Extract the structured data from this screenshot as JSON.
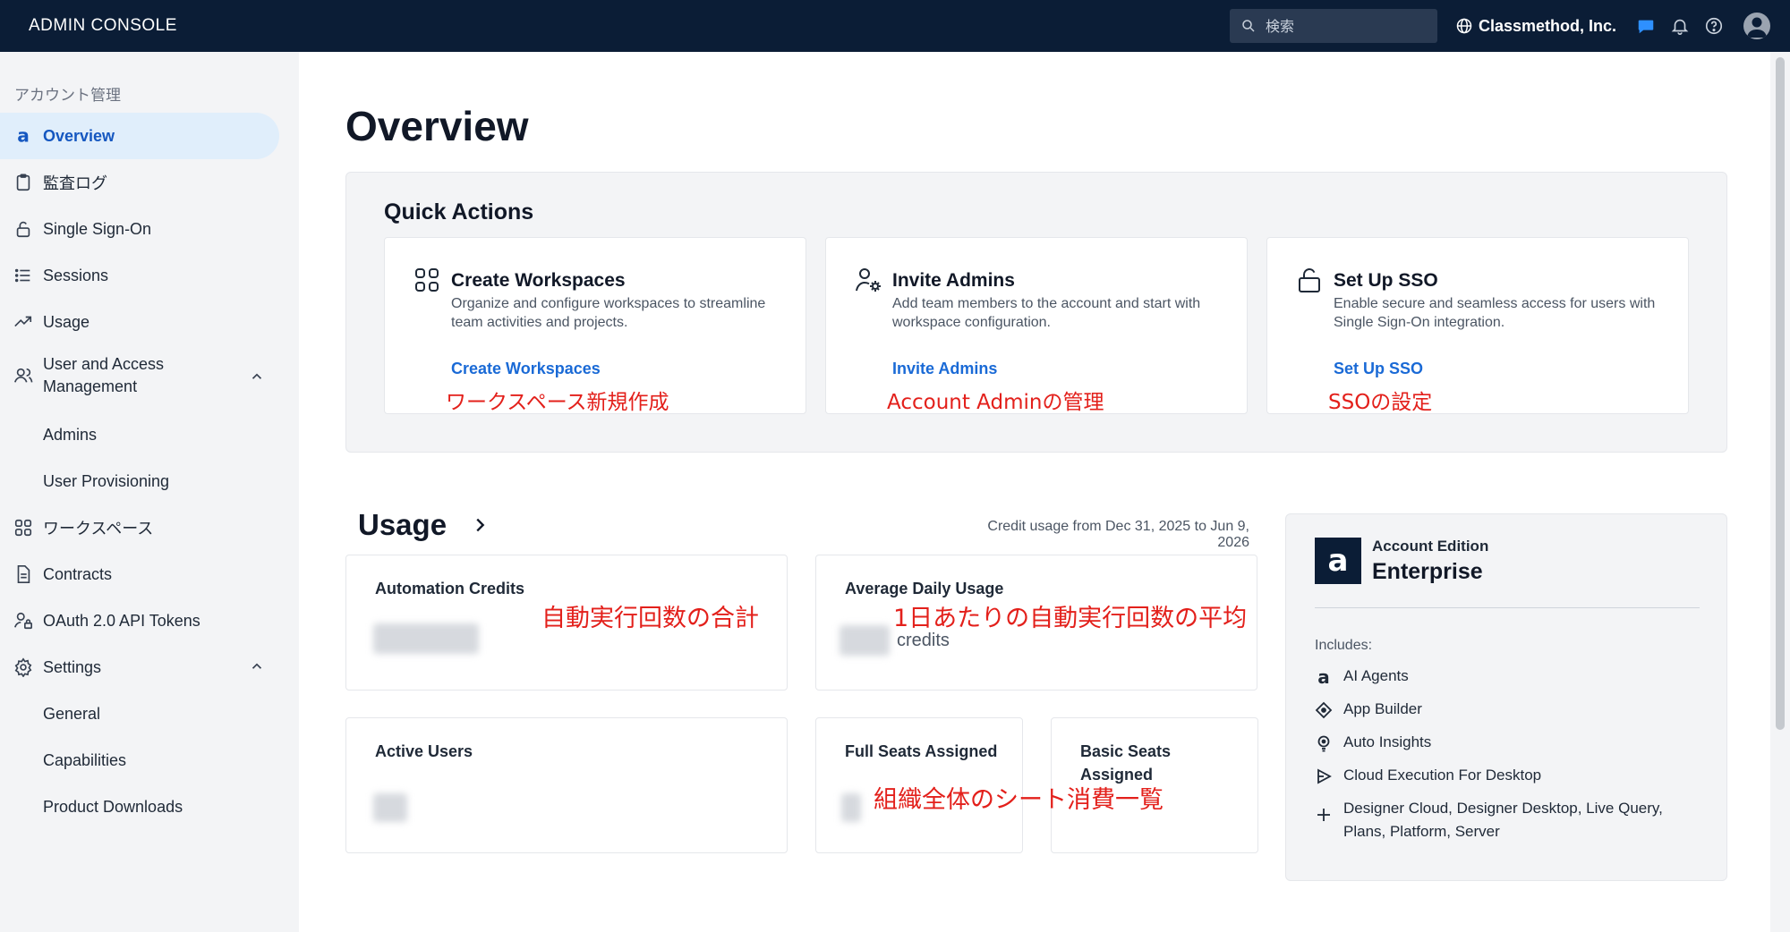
{
  "header": {
    "brand": "ADMIN CONSOLE",
    "search_placeholder": "検索",
    "org_name": "Classmethod, Inc."
  },
  "sidebar": {
    "section_label": "アカウント管理",
    "items": [
      {
        "label": "Overview",
        "icon": "alteryx-a-icon"
      },
      {
        "label": "監査ログ",
        "icon": "clipboard-icon"
      },
      {
        "label": "Single Sign-On",
        "icon": "lock-icon"
      },
      {
        "label": "Sessions",
        "icon": "list-icon"
      },
      {
        "label": "Usage",
        "icon": "trend-icon"
      },
      {
        "label": "User and Access Management",
        "icon": "users-icon"
      },
      {
        "label": "Admins"
      },
      {
        "label": "User Provisioning"
      },
      {
        "label": "ワークスペース",
        "icon": "grid-icon"
      },
      {
        "label": "Contracts",
        "icon": "document-icon"
      },
      {
        "label": "OAuth 2.0 API Tokens",
        "icon": "user-lock-icon"
      },
      {
        "label": "Settings",
        "icon": "gear-icon"
      },
      {
        "label": "General"
      },
      {
        "label": "Capabilities"
      },
      {
        "label": "Product Downloads"
      }
    ]
  },
  "main": {
    "title": "Overview",
    "quick_actions": {
      "title": "Quick Actions",
      "cards": [
        {
          "title": "Create Workspaces",
          "description": "Organize and configure workspaces to streamline team activities and projects.",
          "link": "Create Workspaces",
          "annotation": "ワークスペース新規作成"
        },
        {
          "title": "Invite Admins",
          "description": "Add team members to the account and start with workspace configuration.",
          "link": "Invite Admins",
          "annotation": "Account Adminの管理"
        },
        {
          "title": "Set Up SSO",
          "description": "Enable secure and seamless access for users with Single Sign-On integration.",
          "link": "Set Up SSO",
          "annotation": "SSOの設定"
        }
      ]
    },
    "usage": {
      "title": "Usage",
      "credit_range": "Credit usage from Dec 31, 2025 to Jun 9, 2026",
      "automation_credits_label": "Automation Credits",
      "automation_annotation": "自動実行回数の合計",
      "avg_daily_label": "Average Daily Usage",
      "avg_daily_unit": "credits",
      "avg_daily_annotation": "1日あたりの自動実行回数の平均",
      "active_users_label": "Active Users",
      "full_seats_label": "Full Seats Assigned",
      "basic_seats_label": "Basic Seats Assigned",
      "seats_annotation": "組織全体のシート消費一覧"
    },
    "edition": {
      "label": "Account Edition",
      "name": "Enterprise",
      "includes_label": "Includes:",
      "items": [
        {
          "label": "AI Agents",
          "icon": "alteryx-a-icon"
        },
        {
          "label": "App Builder",
          "icon": "diamond-icon"
        },
        {
          "label": "Auto Insights",
          "icon": "lightbulb-icon"
        },
        {
          "label": "Cloud Execution For Desktop",
          "icon": "play-icon"
        },
        {
          "label": "Designer Cloud, Designer Desktop, Live Query, Plans, Platform, Server",
          "icon": "plus-icon"
        }
      ]
    }
  },
  "colors": {
    "topbar": "#0b1d36",
    "accent": "#1a6ad6",
    "annotation": "#e3201b",
    "active_nav_bg": "#e0eefb"
  }
}
